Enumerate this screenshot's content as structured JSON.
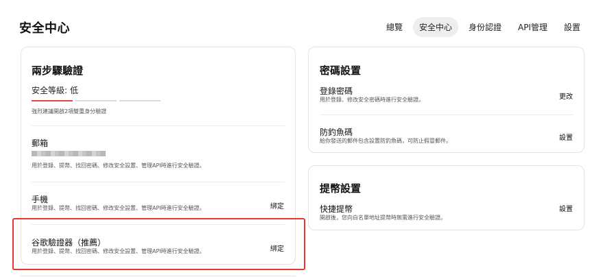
{
  "header": {
    "title": "安全中心",
    "tabs": [
      {
        "label": "總覽"
      },
      {
        "label": "安全中心"
      },
      {
        "label": "身份認證"
      },
      {
        "label": "API管理"
      },
      {
        "label": "設置"
      }
    ],
    "active_tab": "安全中心"
  },
  "two_step": {
    "title": "兩步驟驗證",
    "security_level_label": "安全等級:",
    "security_level_value": "低",
    "level_bars": {
      "filled": 1,
      "total": 3
    },
    "recommend": "強烈建議開啟2項雙重身分驗證",
    "items": [
      {
        "title": "郵箱",
        "masked_value": true,
        "description": "用於登錄、提幣、找回密碼、修改安全設置、管理API時進行安全驗證。",
        "action": ""
      },
      {
        "title": "手機",
        "description": "用於登錄、提幣、找回密碼、修改安全設置、管理API時進行安全驗證。",
        "action": "綁定"
      },
      {
        "title": "谷歌驗證器（推薦）",
        "description": "用於登錄、提幣、找回密碼、修改安全設置、管理API時進行安全驗證。",
        "action": "綁定"
      }
    ]
  },
  "password": {
    "title": "密碼設置",
    "items": [
      {
        "title": "登錄密碼",
        "description": "用於登錄、修改安全密碼時進行安全驗證。",
        "action": "更改"
      },
      {
        "title": "防釣魚碼",
        "description": "給你發送的郵件包含設置防釣魚碼，可防止假冒郵件。",
        "action": "設置"
      }
    ]
  },
  "withdraw": {
    "title": "提幣設置",
    "items": [
      {
        "title": "快捷提幣",
        "description": "開啟後，您向白名單地址提幣時無需進行安全驗證。",
        "action": "設置"
      }
    ]
  },
  "colors": {
    "accent_red": "#e0463f",
    "highlight_red": "#e8352b"
  }
}
